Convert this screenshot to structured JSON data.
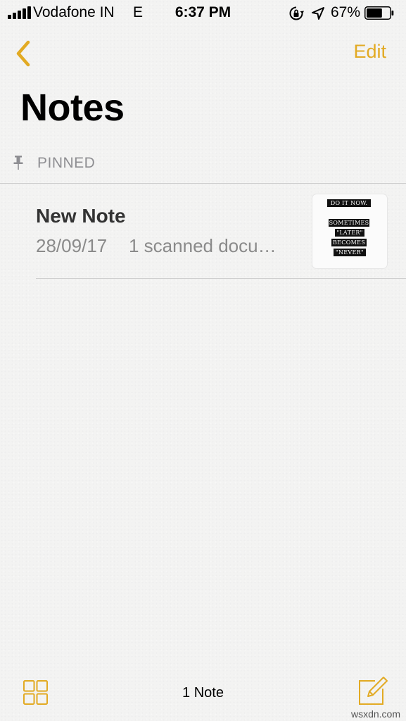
{
  "status_bar": {
    "carrier": "Vodafone IN",
    "network": "E",
    "time": "6:37 PM",
    "battery_percent": "67%",
    "battery_level": 0.67,
    "icons": [
      "signal-icon",
      "rotation-lock-icon",
      "location-arrow-icon",
      "battery-icon"
    ]
  },
  "nav": {
    "back_icon": "chevron-left-icon",
    "edit_label": "Edit",
    "title": "Notes"
  },
  "pinned_section": {
    "label": "PINNED",
    "icon": "pin-icon"
  },
  "notes": [
    {
      "title": "New Note",
      "date": "28/09/17",
      "preview": "1 scanned docu…",
      "thumbnail_text": [
        "DO IT NOW.",
        "SOMETIMES",
        "\"LATER\"",
        "BECOMES",
        "\"NEVER\""
      ]
    }
  ],
  "toolbar": {
    "gallery_icon": "grid-icon",
    "note_count": "1 Note",
    "compose_icon": "compose-icon"
  },
  "watermark": "wsxdn.com",
  "colors": {
    "accent": "#e2aa23",
    "secondary_text": "#8a8a8a",
    "background": "#f3f3f2"
  }
}
